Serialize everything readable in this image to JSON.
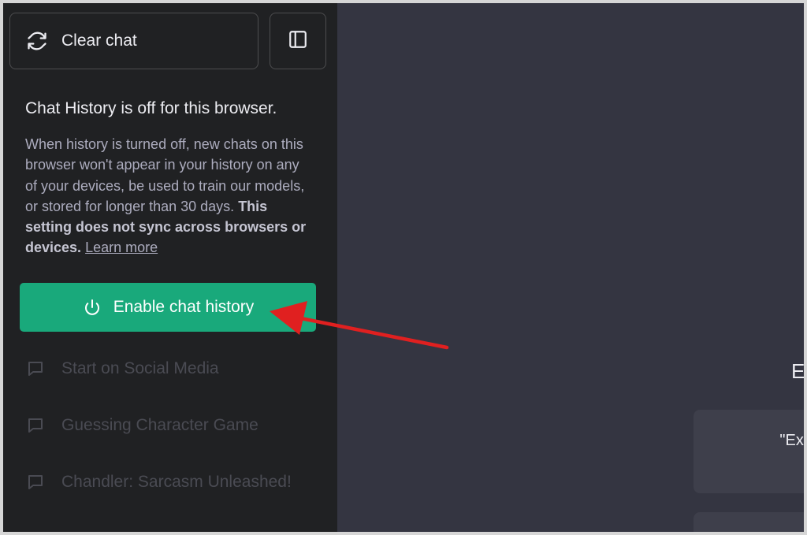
{
  "sidebar": {
    "clear_chat_label": "Clear chat",
    "clear_chat_icon": "refresh-icon",
    "toggle_icon": "sidebar-toggle-icon",
    "history_off_title": "Chat History is off for this browser.",
    "history_off_desc": "When history is turned off, new chats on this browser won't appear in your history on any of your devices, be used to train our models, or stored for longer than 30 days.",
    "history_off_desc_bold": "This setting does not sync across browsers or devices.",
    "learn_more_label": "Learn more",
    "enable_button_label": "Enable chat history",
    "enable_button_icon": "power-icon",
    "enable_button_color": "#19a97b",
    "chats": [
      {
        "label": "Start on Social Media",
        "icon": "message-icon"
      },
      {
        "label": "Guessing Character Game",
        "icon": "message-icon"
      },
      {
        "label": "Chandler: Sarcasm Unleashed!",
        "icon": "message-icon"
      }
    ]
  },
  "main": {
    "heading_partial": "E",
    "example_text": "\"Explain qu sim"
  },
  "annotation": {
    "arrow_color": "#e02020"
  }
}
